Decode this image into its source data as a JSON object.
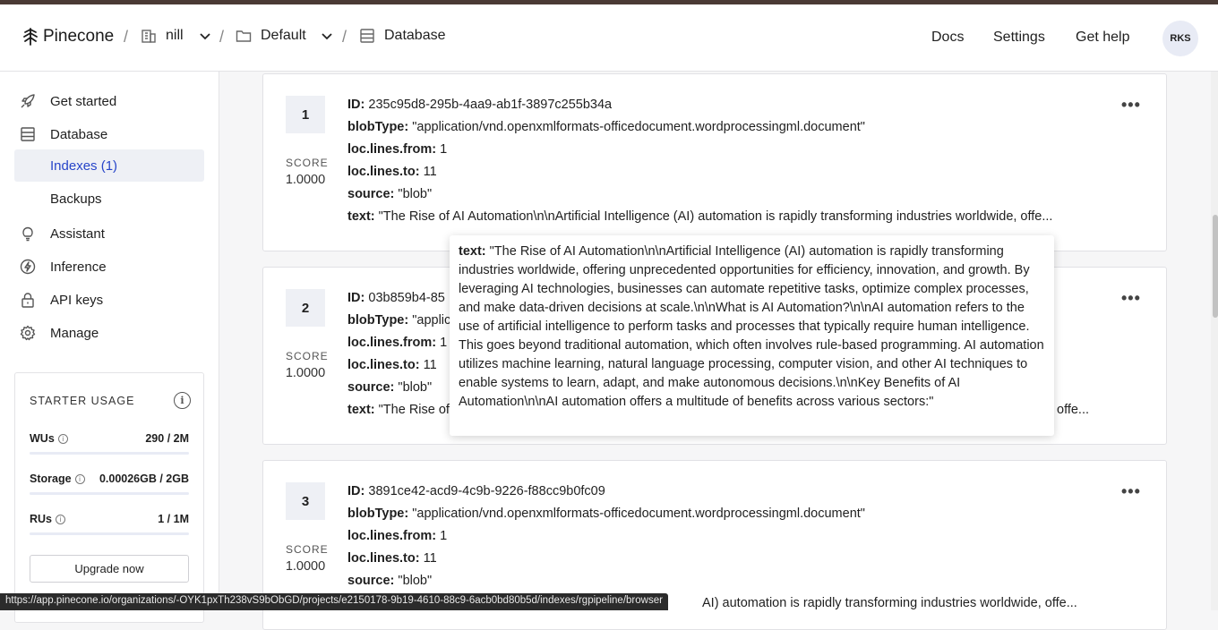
{
  "header": {
    "logo_text": "Pinecone",
    "breadcrumbs": [
      {
        "label": "nill",
        "icon": "building-icon"
      },
      {
        "label": "Default",
        "icon": "folder-icon"
      },
      {
        "label": "Database",
        "icon": "database-icon"
      }
    ],
    "separator": "/",
    "nav": {
      "docs": "Docs",
      "settings": "Settings",
      "help": "Get help"
    },
    "avatar": "RKS"
  },
  "sidebar": {
    "items": [
      {
        "label": "Get started",
        "icon": "rocket-icon"
      },
      {
        "label": "Database",
        "icon": "database-icon"
      },
      {
        "label": "Indexes (1)",
        "active": true
      },
      {
        "label": "Backups"
      },
      {
        "label": "Assistant",
        "icon": "lightbulb-icon"
      },
      {
        "label": "Inference",
        "icon": "bolt-icon"
      },
      {
        "label": "API keys",
        "icon": "lock-icon"
      },
      {
        "label": "Manage",
        "icon": "gear-icon"
      }
    ],
    "usage": {
      "title": "STARTER USAGE",
      "rows": [
        {
          "name": "WUs",
          "value": "290 / 2M",
          "fraction": 0.0001
        },
        {
          "name": "Storage",
          "value": "0.00026GB / 2GB",
          "fraction": 0.0001
        },
        {
          "name": "RUs",
          "value": "1 / 1M",
          "fraction": 0.0001
        }
      ],
      "upgrade_label": "Upgrade now"
    }
  },
  "results": [
    {
      "rank": "1",
      "score_label": "SCORE",
      "score": "1.0000",
      "id_key": "ID:",
      "id": "235c95d8-295b-4aa9-ab1f-3897c255b34a",
      "blob_key": "blobType:",
      "blob": "\"application/vnd.openxmlformats-officedocument.wordprocessingml.document\"",
      "from_key": "loc.lines.from:",
      "from": "1",
      "to_key": "loc.lines.to:",
      "to": "11",
      "source_key": "source:",
      "source": "\"blob\"",
      "text_key": "text:",
      "text": "\"The Rise of AI Automation\\n\\nArtificial Intelligence (AI) automation is rapidly transforming industries worldwide, offe..."
    },
    {
      "rank": "2",
      "score_label": "SCORE",
      "score": "1.0000",
      "id_key": "ID:",
      "id": "03b859b4-85",
      "blob_key": "blobType:",
      "blob": "\"applic",
      "from_key": "loc.lines.from:",
      "from": "1",
      "to_key": "loc.lines.to:",
      "to": "11",
      "source_key": "source:",
      "source": "\"blob\"",
      "text_key": "text:",
      "text": "\"The Rise of",
      "text_tail": "offe..."
    },
    {
      "rank": "3",
      "score_label": "SCORE",
      "score": "1.0000",
      "id_key": "ID:",
      "id": "3891ce42-acd9-4c9b-9226-f88cc9b0fc09",
      "blob_key": "blobType:",
      "blob": "\"application/vnd.openxmlformats-officedocument.wordprocessingml.document\"",
      "from_key": "loc.lines.from:",
      "from": "1",
      "to_key": "loc.lines.to:",
      "to": "11",
      "source_key": "source:",
      "source": "\"blob\"",
      "text_tail": "AI) automation is rapidly transforming industries worldwide, offe..."
    }
  ],
  "tooltip": {
    "key": "text:",
    "value": "\"The Rise of AI Automation\\n\\nArtificial Intelligence (AI) automation is rapidly transforming industries worldwide, offering unprecedented opportunities for efficiency, innovation, and growth. By leveraging AI technologies, businesses can automate repetitive tasks, optimize complex processes, and make data-driven decisions at scale.\\n\\nWhat is AI Automation?\\n\\nAI automation refers to the use of artificial intelligence to perform tasks and processes that typically require human intelligence. This goes beyond traditional automation, which often involves rule-based programming. AI automation utilizes machine learning, natural language processing, computer vision, and other AI techniques to enable systems to learn, adapt, and make autonomous decisions.\\n\\nKey Benefits of AI Automation\\n\\nAI automation offers a multitude of benefits across various sectors:\""
  },
  "status_url": "https://app.pinecone.io/organizations/-OYK1pxTh238vS9bObGD/projects/e2150178-9b19-4610-88c9-6acb0bd80b5d/indexes/rgpipeline/browser",
  "colors": {
    "accent": "#2745c9",
    "bar": "#3f5bd8",
    "topstripe": "#4a3a35"
  }
}
